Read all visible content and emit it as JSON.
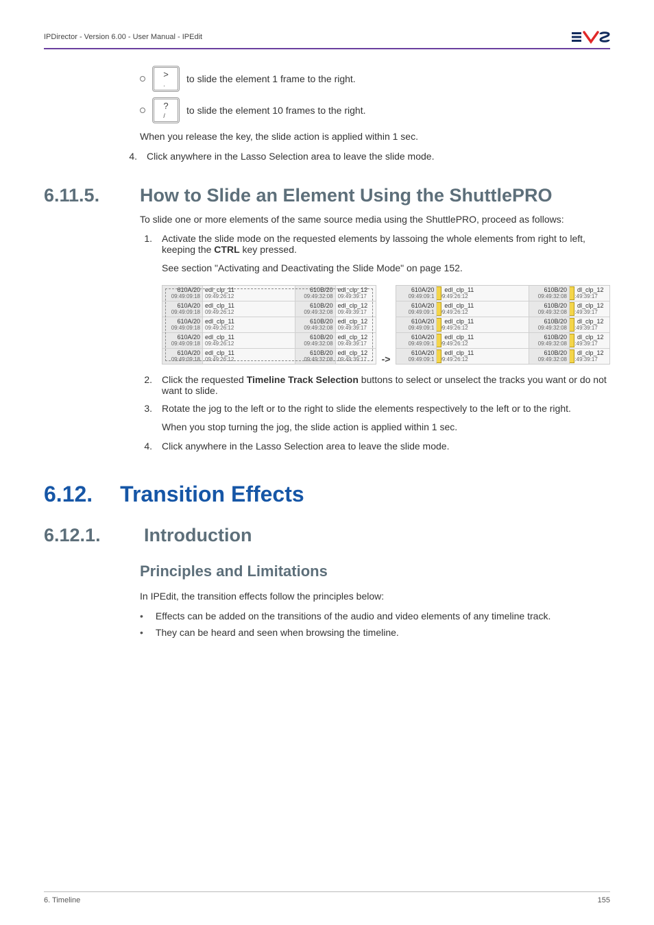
{
  "header": {
    "breadcrumb": "IPDirector - Version 6.00 - User Manual - IPEdit"
  },
  "logo": {
    "alt": "EVS"
  },
  "key1": {
    "label": ">",
    "sub": "."
  },
  "key2": {
    "label": "?",
    "sub": "/"
  },
  "text": {
    "slide1": "to slide the element 1 frame to the right.",
    "slide10": "to slide the element 10 frames to the right.",
    "release": "When you release the key, the slide action is applied within 1 sec.",
    "step4a": "Click anywhere in the Lasso Selection area to leave the slide mode.",
    "sec6115_num": "6.11.5.",
    "sec6115_title": "How to Slide an Element Using the ShuttlePRO",
    "shuttle_intro": "To slide one or more elements of the same source media using the ShuttlePRO, proceed as follows:",
    "step1_pre": "Activate the slide mode on the requested elements by lassoing the whole elements from right to left, keeping the ",
    "step1_bold": "CTRL",
    "step1_post": " key pressed.",
    "see_section": "See section \"Activating and Deactivating the Slide Mode\" on page 152.",
    "step2_pre": "Click the requested ",
    "step2_bold": "Timeline Track Selection",
    "step2_post": " buttons to select or unselect the tracks you want or do not want to slide.",
    "step3": "Rotate the jog to the left or to the right to slide the elements respectively to the left or to the right.",
    "stopjog": "When you stop turning the jog, the slide action is applied within 1 sec.",
    "step4b": "Click anywhere in the Lasso Selection area to leave the slide mode.",
    "sec612_num": "6.12.",
    "sec612_title": "Transition Effects",
    "sec6121_num": "6.12.1.",
    "sec6121_title": "Introduction",
    "h3_principles": "Principles and Limitations",
    "principles_intro": "In IPEdit, the transition effects follow the principles below:",
    "bp1": "Effects can be added on the transitions of the audio and video elements of any timeline track.",
    "bp2": "They can be heard and seen when browsing the timeline."
  },
  "numbers": {
    "n1": "1.",
    "n2": "2.",
    "n3": "3.",
    "n4": "4."
  },
  "shot": {
    "leftA_id": "610A/20",
    "leftA_tc": "09:49:09:18",
    "leftA_name": "edl_clp_11",
    "leftA_ntc": "09:49:26:12",
    "leftB_id": "610B/20",
    "leftB_tc": "09:49:32:08",
    "leftB_name": "edl_clp_12",
    "leftB_ntc": "09:49:39:17",
    "rightA_id": "610A/20",
    "rightA_tc": "09:49:09:1",
    "rightA_name": "edl_clp_11",
    "rightA_ntc": "09:49:26:12",
    "rightB_id": "610B/20",
    "rightB_tc": "09:49:32:08",
    "rightB_name": "dl_clp_12",
    "rightB_ntc": "9:49:39:17"
  },
  "footer": {
    "chapter": "6. Timeline",
    "page": "155"
  }
}
